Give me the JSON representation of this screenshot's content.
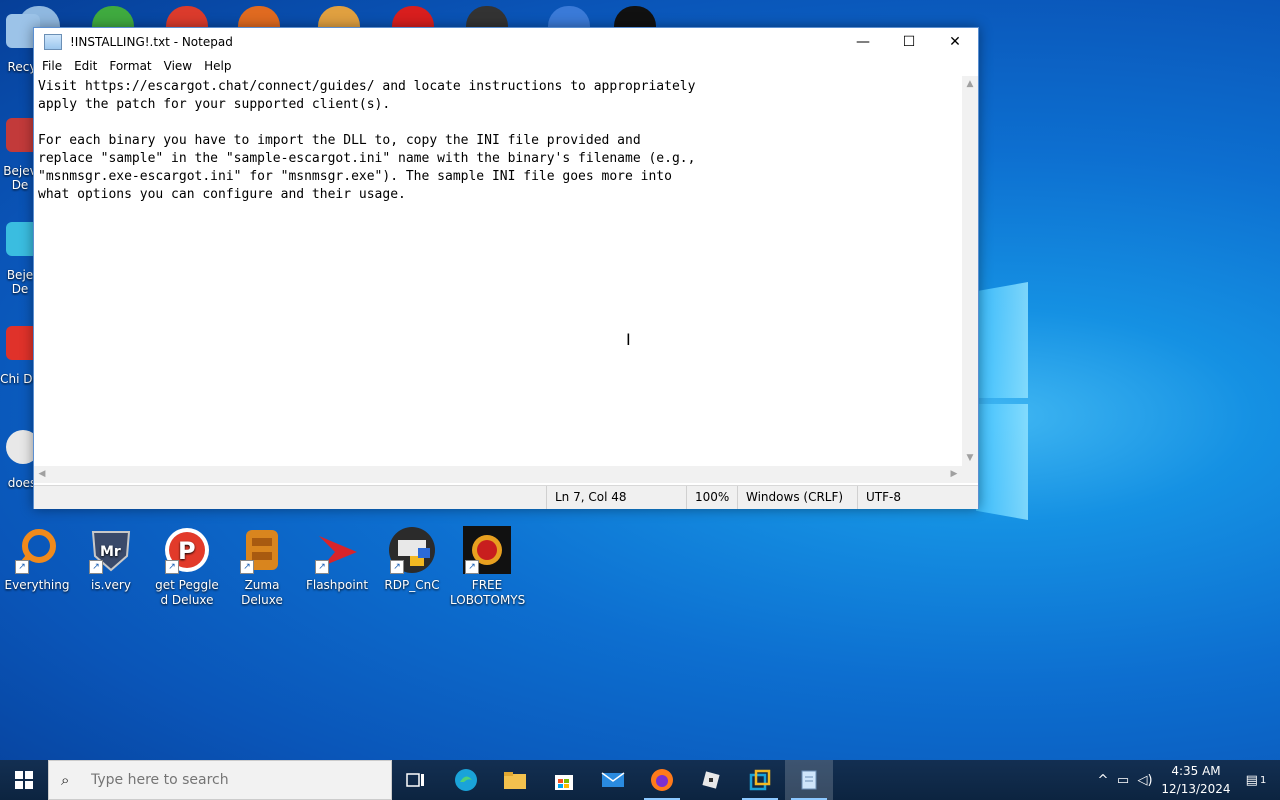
{
  "window": {
    "title": "!INSTALLING!.txt - Notepad",
    "minimize_glyph": "—",
    "maximize_glyph": "☐",
    "close_glyph": "✕"
  },
  "menu": {
    "file": "File",
    "edit": "Edit",
    "format": "Format",
    "view": "View",
    "help": "Help"
  },
  "editor": {
    "text": "Visit https://escargot.chat/connect/guides/ and locate instructions to appropriately\napply the patch for your supported client(s).\n\nFor each binary you have to import the DLL to, copy the INI file provided and\nreplace \"sample\" in the \"sample-escargot.ini\" name with the binary's filename (e.g.,\n\"msnmsgr.exe-escargot.ini\" for \"msnmsgr.exe\"). The sample INI file goes more into\nwhat options you can configure and their usage."
  },
  "statusbar": {
    "position": "Ln 7, Col 48",
    "zoom": "100%",
    "line_ending": "Windows (CRLF)",
    "encoding": "UTF-8"
  },
  "desktop": {
    "left_labels": [
      "Recy",
      "Bejev De",
      "Beje De",
      "Chi De",
      "does"
    ],
    "icons": [
      {
        "label": "Everything",
        "color": "#f08a1c"
      },
      {
        "label": "is.very",
        "color": "#3a4a6a"
      },
      {
        "label": "get Peggle d Deluxe",
        "color": "#e23a2a"
      },
      {
        "label": "Zuma Deluxe",
        "color": "#d9851e"
      },
      {
        "label": "Flashpoint",
        "color": "#d8242a"
      },
      {
        "label": "RDP_CnC",
        "color": "#2b2b2b"
      },
      {
        "label": "FREE LOBOTOMYS",
        "color": "#111111"
      }
    ]
  },
  "taskbar": {
    "search_placeholder": "Type here to search",
    "time": "4:35 AM",
    "date": "12/13/2024",
    "notification_count": "1"
  }
}
